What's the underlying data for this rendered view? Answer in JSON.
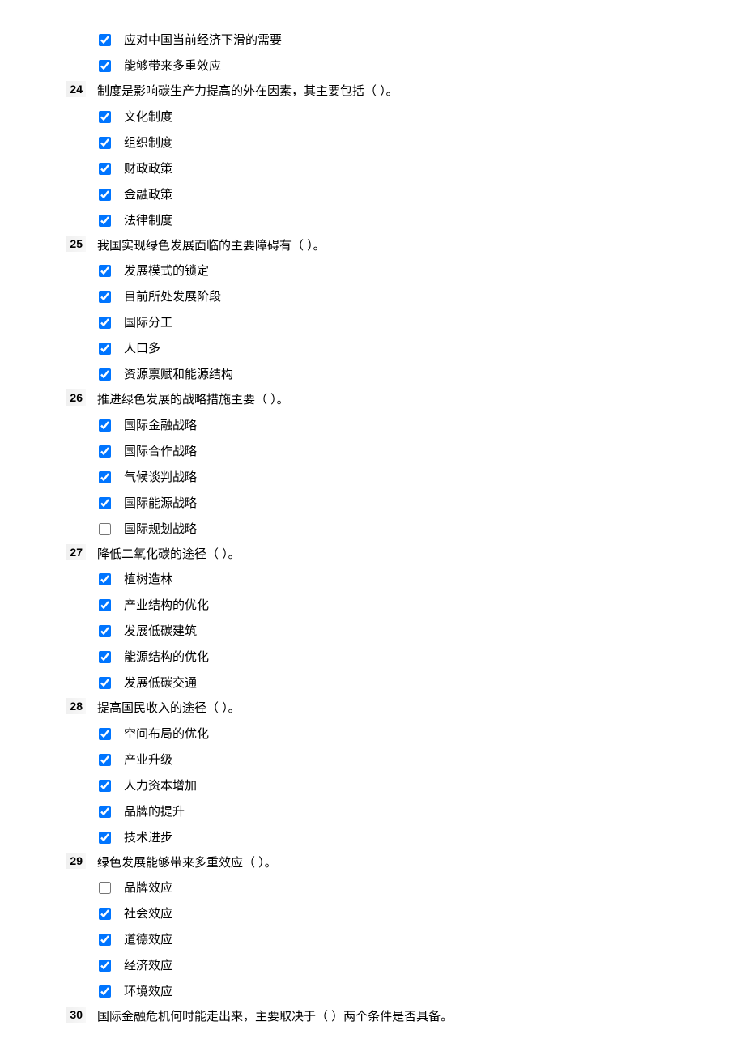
{
  "orphan_options": [
    {
      "checked": true,
      "text": "应对中国当前经济下滑的需要"
    },
    {
      "checked": true,
      "text": "能够带来多重效应"
    }
  ],
  "questions": [
    {
      "num": "24",
      "text": "制度是影响碳生产力提高的外在因素，其主要包括（ ）。",
      "options": [
        {
          "checked": true,
          "text": "文化制度"
        },
        {
          "checked": true,
          "text": "组织制度"
        },
        {
          "checked": true,
          "text": "财政政策"
        },
        {
          "checked": true,
          "text": "金融政策"
        },
        {
          "checked": true,
          "text": "法律制度"
        }
      ]
    },
    {
      "num": "25",
      "text": "我国实现绿色发展面临的主要障碍有（ ）。",
      "options": [
        {
          "checked": true,
          "text": "发展模式的锁定"
        },
        {
          "checked": true,
          "text": "目前所处发展阶段"
        },
        {
          "checked": true,
          "text": "国际分工"
        },
        {
          "checked": true,
          "text": "人口多"
        },
        {
          "checked": true,
          "text": "资源禀赋和能源结构"
        }
      ]
    },
    {
      "num": "26",
      "text": "推进绿色发展的战略措施主要（ ）。",
      "options": [
        {
          "checked": true,
          "text": "国际金融战略"
        },
        {
          "checked": true,
          "text": "国际合作战略"
        },
        {
          "checked": true,
          "text": "气候谈判战略"
        },
        {
          "checked": true,
          "text": "国际能源战略"
        },
        {
          "checked": false,
          "text": "国际规划战略"
        }
      ]
    },
    {
      "num": "27",
      "text": "降低二氧化碳的途径（ ）。",
      "options": [
        {
          "checked": true,
          "text": "植树造林"
        },
        {
          "checked": true,
          "text": "产业结构的优化"
        },
        {
          "checked": true,
          "text": "发展低碳建筑"
        },
        {
          "checked": true,
          "text": "能源结构的优化"
        },
        {
          "checked": true,
          "text": "发展低碳交通"
        }
      ]
    },
    {
      "num": "28",
      "text": "提高国民收入的途径（ ）。",
      "options": [
        {
          "checked": true,
          "text": "空间布局的优化"
        },
        {
          "checked": true,
          "text": "产业升级"
        },
        {
          "checked": true,
          "text": "人力资本增加"
        },
        {
          "checked": true,
          "text": "品牌的提升"
        },
        {
          "checked": true,
          "text": "技术进步"
        }
      ]
    },
    {
      "num": "29",
      "text": "绿色发展能够带来多重效应（ ）。",
      "options": [
        {
          "checked": false,
          "text": "品牌效应"
        },
        {
          "checked": true,
          "text": "社会效应"
        },
        {
          "checked": true,
          "text": "道德效应"
        },
        {
          "checked": true,
          "text": "经济效应"
        },
        {
          "checked": true,
          "text": "环境效应"
        }
      ]
    },
    {
      "num": "30",
      "text": "国际金融危机何时能走出来，主要取决于（ ）两个条件是否具备。",
      "options": []
    }
  ]
}
